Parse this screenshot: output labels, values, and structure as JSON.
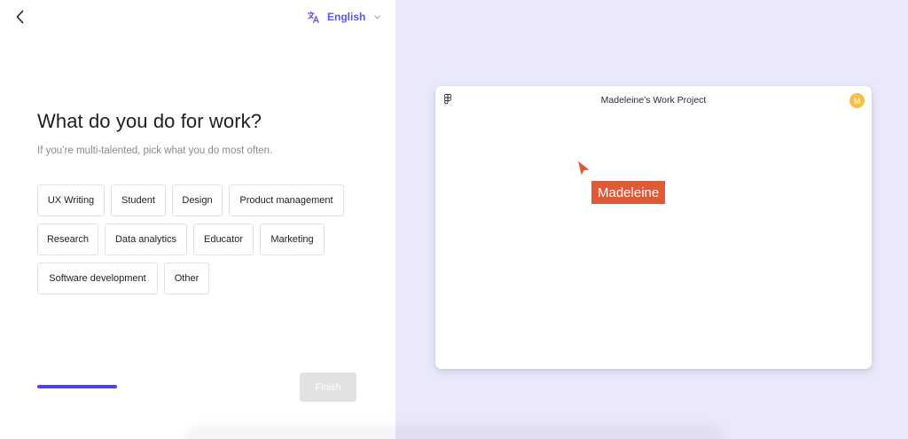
{
  "header": {
    "back_icon": "chevron-left-icon",
    "language": {
      "icon": "translate-icon",
      "label": "English",
      "chevron_icon": "chevron-down-icon",
      "color": "#5b54e8"
    }
  },
  "main": {
    "title": "What do you do for work?",
    "subtitle": "If you’re multi-talented, pick what you do most often.",
    "options": [
      "UX Writing",
      "Student",
      "Design",
      "Product management",
      "Research",
      "Data analytics",
      "Educator",
      "Marketing",
      "Software development",
      "Other"
    ]
  },
  "footer": {
    "progress": 1.0,
    "progress_color": "#4b48e0",
    "finish_label": "Finish"
  },
  "preview": {
    "background_color": "#e9e9fb",
    "file_icon": "figma-logo-icon",
    "project_title": "Madeleine’s Work Project",
    "avatar_initial": "M",
    "avatar_color": "#f5c04a",
    "cursor_icon": "cursor-arrow-icon",
    "cursor_name": "Madeleine",
    "cursor_color": "#e05a38"
  }
}
